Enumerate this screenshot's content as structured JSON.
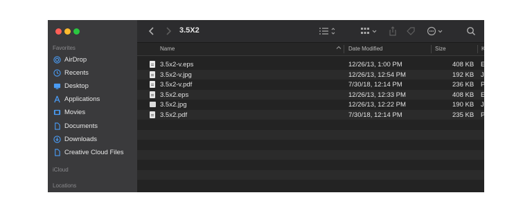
{
  "window": {
    "title": "3.5X2"
  },
  "sidebar": {
    "favorites_header": "Favorites",
    "items": [
      {
        "label": "AirDrop",
        "icon": "airdrop-icon"
      },
      {
        "label": "Recents",
        "icon": "clock-icon"
      },
      {
        "label": "Desktop",
        "icon": "desktop-icon"
      },
      {
        "label": "Applications",
        "icon": "applications-icon"
      },
      {
        "label": "Movies",
        "icon": "film-icon"
      },
      {
        "label": "Documents",
        "icon": "document-icon"
      },
      {
        "label": "Downloads",
        "icon": "download-icon"
      },
      {
        "label": "Creative Cloud Files",
        "icon": "file-icon"
      }
    ],
    "icloud_header": "iCloud",
    "locations_header": "Locations"
  },
  "columns": {
    "name": "Name",
    "date": "Date Modified",
    "size": "Size",
    "kind": "K"
  },
  "files": [
    {
      "name": "3.5x2-v.eps",
      "date": "12/26/13, 1:00 PM",
      "size": "408 KB",
      "kind": "E",
      "icon": "doc"
    },
    {
      "name": "3.5x2-v.jpg",
      "date": "12/26/13, 12:54 PM",
      "size": "192 KB",
      "kind": "J",
      "icon": "doc"
    },
    {
      "name": "3.5x2-v.pdf",
      "date": "7/30/18, 12:14 PM",
      "size": "236 KB",
      "kind": "P",
      "icon": "doc"
    },
    {
      "name": "3.5x2.eps",
      "date": "12/26/13, 12:33 PM",
      "size": "408 KB",
      "kind": "E",
      "icon": "doc"
    },
    {
      "name": "3.5x2.jpg",
      "date": "12/26/13, 12:22 PM",
      "size": "190 KB",
      "kind": "J",
      "icon": "img"
    },
    {
      "name": "3.5x2.pdf",
      "date": "7/30/18, 12:14 PM",
      "size": "235 KB",
      "kind": "P",
      "icon": "doc"
    }
  ],
  "colors": {
    "sidebar": "#3a3a3c",
    "content": "#232323",
    "alt_row": "#2b2b2b",
    "accent_icon": "#4a9cf5"
  }
}
